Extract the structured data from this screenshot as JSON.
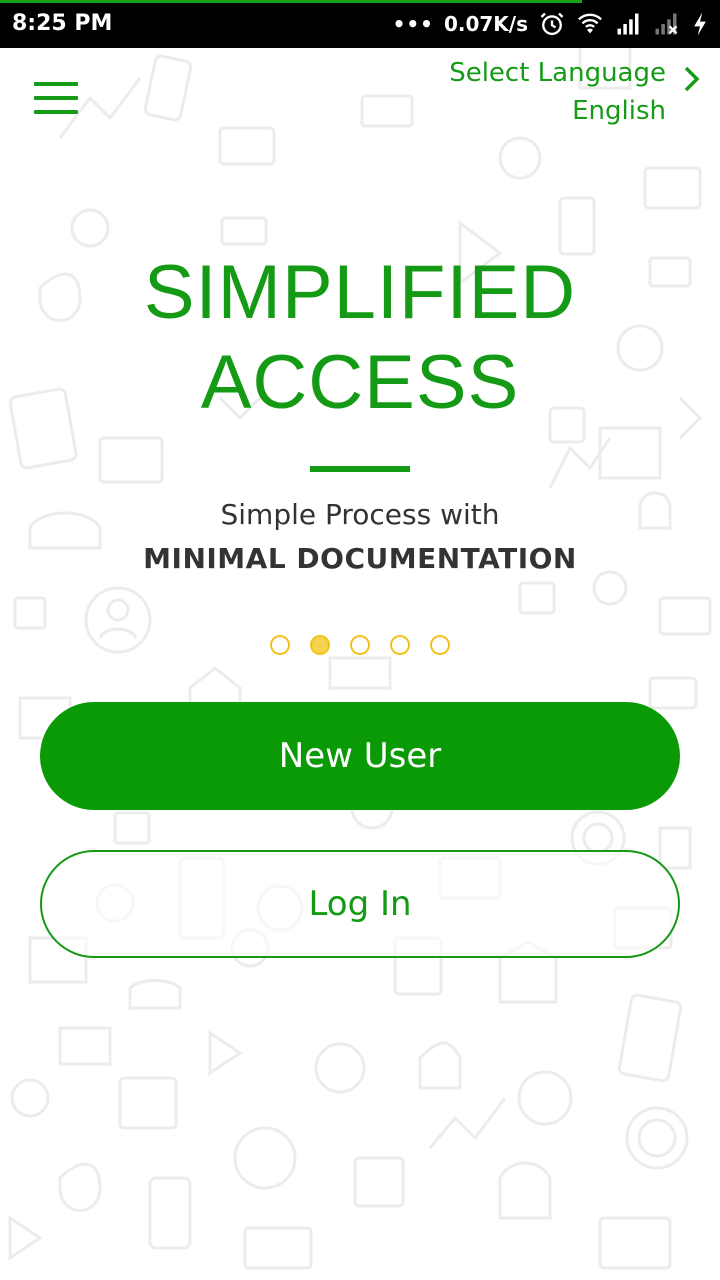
{
  "status_bar": {
    "time": "8:25 PM",
    "dots": "•••",
    "network_speed": "0.07K/s",
    "icons": [
      "alarm-icon",
      "wifi-icon",
      "signal-icon",
      "signal-no-data-icon",
      "charging-icon"
    ],
    "progress": 0.81
  },
  "header": {
    "menu_icon": "hamburger-menu-icon",
    "language_label": "Select Language",
    "language_value": "English",
    "chevron_icon": "chevron-right-icon"
  },
  "hero": {
    "title_line1": "SIMPLIFIED",
    "title_line2": "ACCESS",
    "subtitle": "Simple Process with",
    "subtitle_bold": "MINIMAL DOCUMENTATION"
  },
  "pager": {
    "count": 5,
    "active_index": 1
  },
  "actions": {
    "new_user": "New User",
    "login": "Log In"
  },
  "colors": {
    "brand_green": "#149a14",
    "button_green": "#099a05",
    "pager_yellow": "#f3c31b",
    "text_dark": "#333333"
  }
}
